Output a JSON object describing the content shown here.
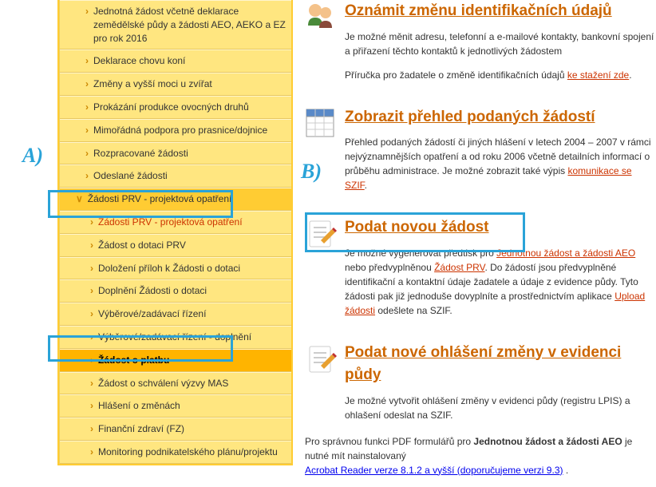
{
  "annotations": {
    "a": "A)",
    "b": "B)"
  },
  "sidebar": {
    "items": [
      {
        "label": "Jednotná žádost včetně deklarace zemědělské půdy a žádosti AEO, AEKO a EZ pro rok 2016"
      },
      {
        "label": "Deklarace chovu koní"
      },
      {
        "label": "Změny a vyšší moci u zvířat"
      },
      {
        "label": "Prokázání produkce ovocných druhů"
      },
      {
        "label": "Mimořádná podpora pro prasnice/dojnice"
      },
      {
        "label": "Rozpracované žádosti"
      },
      {
        "label": "Odeslané žádosti"
      },
      {
        "label": "Žádosti PRV - projektová opatření"
      },
      {
        "label": "Žádosti PRV - projektová opatření"
      },
      {
        "label": "Žádost o dotaci PRV"
      },
      {
        "label": "Doložení příloh k Žádosti o dotaci"
      },
      {
        "label": "Doplnění Žádosti o dotaci"
      },
      {
        "label": "Výběrové/zadávací řízení"
      },
      {
        "label": "Výběrové/zadávací řízení - doplnění"
      },
      {
        "label": "Žádost o platbu"
      },
      {
        "label": "Žádost o schválení výzvy MAS"
      },
      {
        "label": "Hlášení o změnách"
      },
      {
        "label": "Finanční zdraví (FZ)"
      },
      {
        "label": "Monitoring podnikatelského plánu/projektu"
      }
    ]
  },
  "sections": [
    {
      "title": "Oznámit změnu identifikačních údajů",
      "body1": "Je možné měnit adresu, telefonní a e-mailové kontakty, bankovní spojení a přiřazení těchto kontaktů k jednotlivých žádostem",
      "body2a": "Příručka pro žadatele o změně identifikačních údajů ",
      "link2": "ke stažení zde",
      "body2b": "."
    },
    {
      "title": "Zobrazit přehled podaných žádostí",
      "body1a": "Přehled podaných žádostí či jiných hlášení v letech 2004 – 2007 v rámci nejvýznamnějších opatření a od roku 2006 včetně detailních informací o průběhu administrace. Je možné zobrazit také výpis ",
      "link1": "komunikace se SZIF",
      "body1b": "."
    },
    {
      "title": "Podat novou žádost",
      "body1a": "Je možné vygenerovat předtisk pro ",
      "link1": "Jednotnou žádost a žádosti AEO",
      "mid1": " nebo předvyplněnou ",
      "link2": "Žádost PRV",
      "mid2": ". Do žádostí jsou předvyplněné identifikační a kontaktní údaje žadatele a údaje z evidence půdy. Tyto žádosti pak již jednoduše dovyplníte a prostřednictvím aplikace ",
      "link3": "Upload žádosti",
      "end": " odešlete na SZIF."
    },
    {
      "title": "Podat nové ohlášení změny v evidenci půdy",
      "body1": "Je možné vytvořit ohlášení změny v evidenci půdy (registru LPIS) a ohlašení odeslat na SZIF."
    }
  ],
  "footer": {
    "pre": "Pro správnou funkci PDF formulářů pro ",
    "bold": "Jednotnou žádost a žádosti AEO",
    "post": " je nutné mít nainstalovaný ",
    "link": "Acrobat Reader verze 8.1.2 a vyšší (doporučujeme verzi 9.3)",
    "tail": " ."
  }
}
